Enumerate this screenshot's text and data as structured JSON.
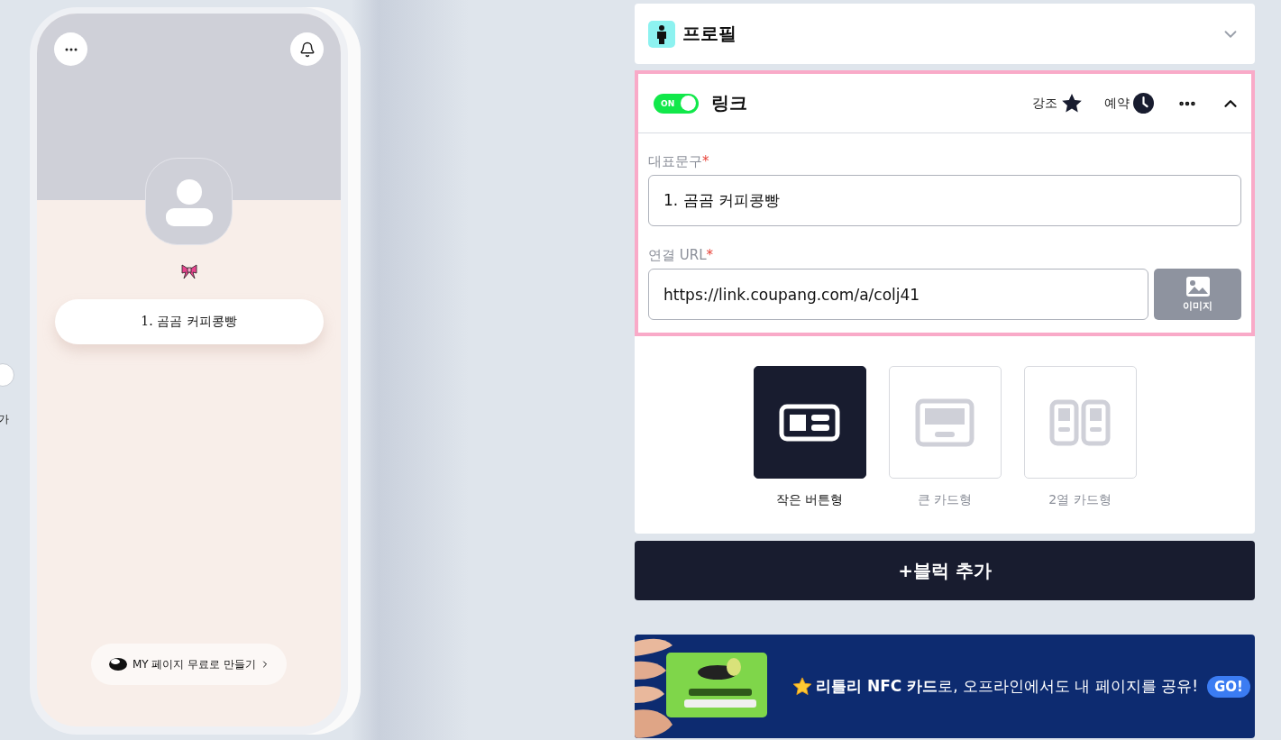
{
  "edge": {
    "label": "가"
  },
  "preview": {
    "links": [
      {
        "label": "1. 곰곰 커피콩빵"
      }
    ],
    "footer_button": "MY 페이지 무료로 만들기"
  },
  "profile_block": {
    "title": "프로필",
    "expanded": false
  },
  "link_block": {
    "enabled": true,
    "toggle_label": "ON",
    "title": "링크",
    "expanded": true,
    "actions": [
      {
        "kind": "highlight",
        "label": "강조"
      },
      {
        "kind": "schedule",
        "label": "예약"
      }
    ],
    "fields": [
      {
        "label": "대표문구",
        "required_mark": "*",
        "value": "1. 곰곰 커피콩빵"
      },
      {
        "label": "연결 URL",
        "required_mark": "*",
        "value": "https://link.coupang.com/a/colj41"
      }
    ],
    "image_button": "이미지",
    "layouts": [
      {
        "kind": "small",
        "label": "작은 버튼형",
        "selected": true
      },
      {
        "kind": "large",
        "label": "큰 카드형",
        "selected": false
      },
      {
        "kind": "double",
        "label": "2열 카드형",
        "selected": false
      }
    ]
  },
  "add_block_button": "+블럭 추가",
  "promo": {
    "text": "**리틀리 NFC 카드**로, 오프라인에서도 내 페이지를 공유!",
    "badge": "GO!"
  }
}
